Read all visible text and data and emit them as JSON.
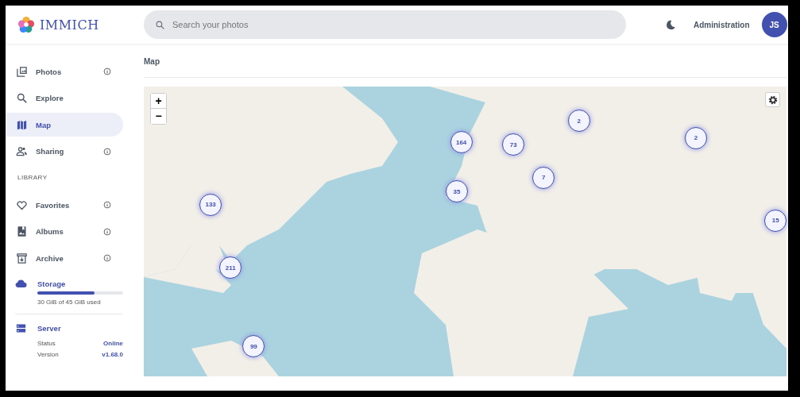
{
  "header": {
    "logo": "IMMICH",
    "search": {
      "placeholder": "Search your photos"
    },
    "admin_link": "Administration",
    "avatar": "JS"
  },
  "sidebar": {
    "items": [
      {
        "label": "Photos",
        "selected": false,
        "info": true
      },
      {
        "label": "Explore",
        "selected": false,
        "info": false
      },
      {
        "label": "Map",
        "selected": true,
        "info": false
      },
      {
        "label": "Sharing",
        "selected": false,
        "info": true
      }
    ],
    "section_title": "LIBRARY",
    "library": [
      {
        "label": "Favorites",
        "selected": false,
        "info": true
      },
      {
        "label": "Albums",
        "selected": false,
        "info": true
      },
      {
        "label": "Archive",
        "selected": false,
        "info": true
      }
    ],
    "storage": {
      "title": "Storage",
      "level": 0.67,
      "usage": "30 GiB of 45 GiB used"
    },
    "server": {
      "title": "Server",
      "rows": [
        {
          "label": "Status",
          "value": "Online"
        },
        {
          "label": "Version",
          "value": "v1.68.0"
        }
      ]
    }
  },
  "page": {
    "title": "Map",
    "zoom_in": "+",
    "zoom_out": "−",
    "clusters": [
      "164",
      "73",
      "2",
      "2",
      "7",
      "35",
      "133",
      "15",
      "211",
      "99"
    ]
  }
}
